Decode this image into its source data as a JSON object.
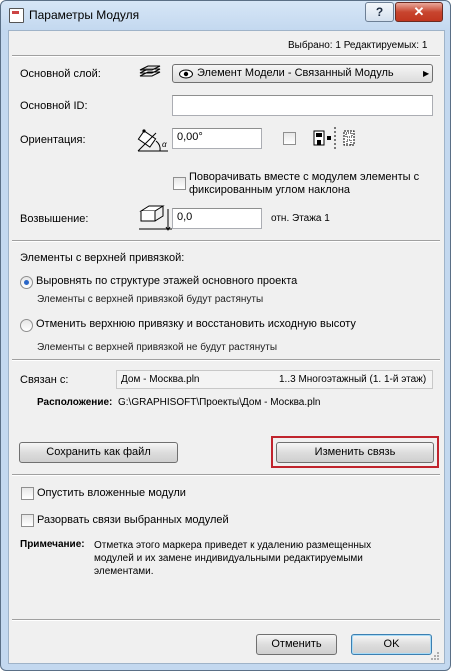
{
  "window": {
    "title": "Параметры Модуля",
    "help": "?",
    "close": "✕"
  },
  "status": {
    "text": "Выбрано: 1 Редактируемых: 1"
  },
  "layer": {
    "label": "Основной слой:",
    "value": "Элемент Модели - Связанный Модуль"
  },
  "main_id": {
    "label": "Основной ID:",
    "value": ""
  },
  "orientation": {
    "label": "Ориентация:",
    "value": "0,00°",
    "rotate_text": "Поворачивать вместе с модулем элементы с фиксированным углом наклона"
  },
  "elevation": {
    "label": "Возвышение:",
    "value": "0,0",
    "reference": "отн. Этажа 1"
  },
  "top_linked": {
    "heading": "Элементы с верхней привязкой:",
    "options": [
      {
        "label": "Выровнять по структуре этажей основного проекта",
        "note": "Элементы с верхней привязкой будут растянуты",
        "selected": true
      },
      {
        "label": "Отменить верхнюю привязку и восстановить исходную высоту",
        "note": "Элементы с верхней привязкой не будут растянуты",
        "selected": false
      }
    ]
  },
  "link": {
    "label": "Связан с:",
    "file": "Дом - Москва.pln",
    "story": "1..3 Многоэтажный (1. 1-й этаж)",
    "location_label": "Расположение:",
    "location_value": "G:\\GRAPHISOFT\\Проекты\\Дом - Москва.pln"
  },
  "buttons": {
    "save_as_file": "Сохранить как файл",
    "change_link": "Изменить связь",
    "cancel": "Отменить",
    "ok": "OK"
  },
  "options": {
    "skip_nested": "Опустить вложенные модули",
    "break_links": "Разорвать связи выбранных модулей"
  },
  "note": {
    "label": "Примечание:",
    "text": "Отметка этого маркера приведет к удалению размещенных модулей и их замене индивидуальными редактируемыми элементами."
  },
  "colors": {
    "highlight": "#c0242d",
    "title_bar": "#c3d8ef",
    "radio_selected": "#2a66c8"
  }
}
